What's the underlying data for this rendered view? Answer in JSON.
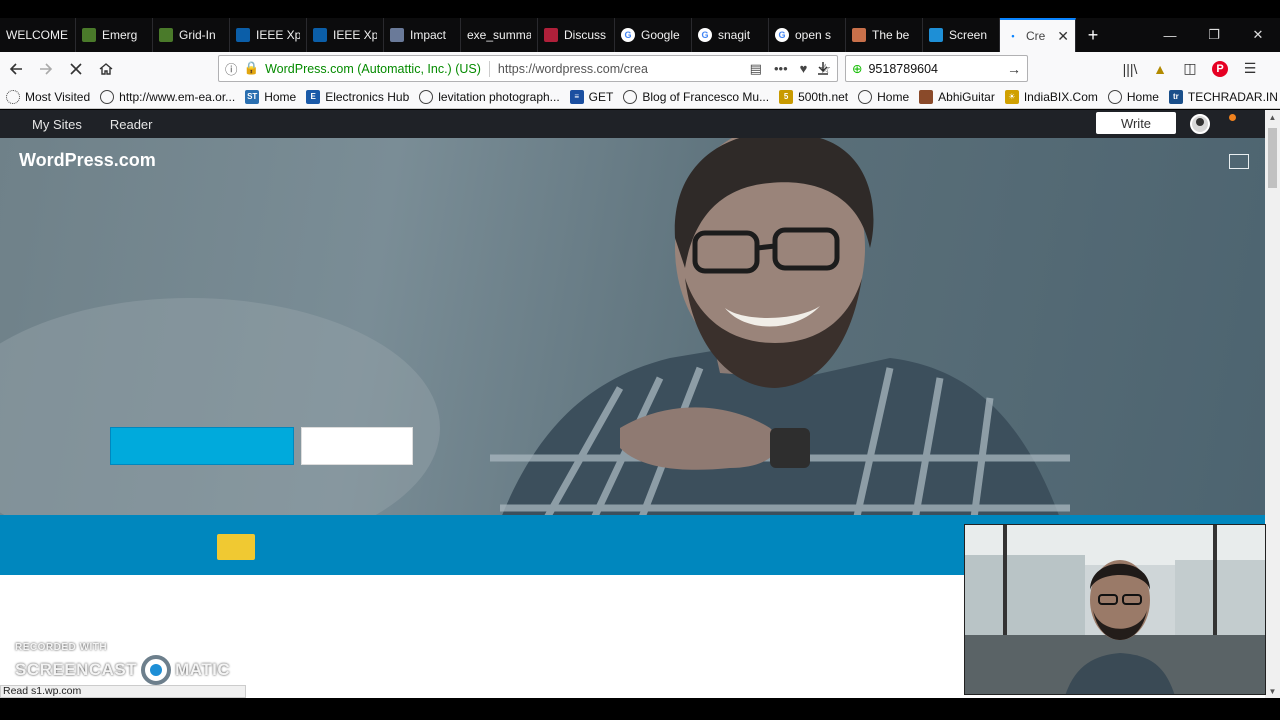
{
  "browser": {
    "tabs": [
      {
        "label": "WELCOME",
        "icon": "none"
      },
      {
        "label": "Emerg",
        "icon": "leaf-icon"
      },
      {
        "label": "Grid-In",
        "icon": "leaf-icon"
      },
      {
        "label": "IEEE Xp",
        "icon": "ieee-icon"
      },
      {
        "label": "IEEE Xp",
        "icon": "ieee-icon"
      },
      {
        "label": "Impact",
        "icon": "globe-icon"
      },
      {
        "label": "exe_summa",
        "icon": "none"
      },
      {
        "label": "Discuss",
        "icon": "chat-icon"
      },
      {
        "label": "Google",
        "icon": "google-icon"
      },
      {
        "label": "snagit",
        "icon": "google-icon"
      },
      {
        "label": "open s",
        "icon": "google-icon"
      },
      {
        "label": "The be",
        "icon": "person-icon"
      },
      {
        "label": "Screen",
        "icon": "screencast-icon"
      },
      {
        "label": "Cre",
        "icon": "loading-icon",
        "active": true
      }
    ],
    "new_tab_label": "+",
    "window_controls": [
      "—",
      "❐",
      "✕"
    ],
    "identity": "WordPress.com (Automattic, Inc.) (US)",
    "url": "https://wordpress.com/crea",
    "search_value": "9518789604",
    "bookmarks": [
      {
        "label": "Most Visited",
        "icon": "gear-icon"
      },
      {
        "label": "http://www.em-ea.or...",
        "icon": "globe-icon"
      },
      {
        "label": "Home",
        "icon": "st-icon"
      },
      {
        "label": "Electronics Hub",
        "icon": "e-icon"
      },
      {
        "label": "levitation photograph...",
        "icon": "globe-icon"
      },
      {
        "label": "GET",
        "icon": "get-icon"
      },
      {
        "label": "Blog of Francesco Mu...",
        "icon": "globe-icon"
      },
      {
        "label": "500th.net",
        "icon": "50-icon"
      },
      {
        "label": "Home",
        "icon": "globe-icon"
      },
      {
        "label": "AbhiGuitar",
        "icon": "image-icon"
      },
      {
        "label": "IndiaBIX.Com",
        "icon": "bix-icon"
      },
      {
        "label": "Home",
        "icon": "globe-icon"
      },
      {
        "label": "TECHRADAR.IN",
        "icon": "tr-icon"
      }
    ],
    "status_text": "Read s1.wp.com"
  },
  "masterbar": {
    "my_sites": "My Sites",
    "reader": "Reader",
    "write": "Write"
  },
  "hero": {
    "brand": "WordPress.com"
  },
  "watermark": {
    "line1": "RECORDED WITH",
    "left": "SCREENCAST",
    "right": "MATIC"
  },
  "colors": {
    "masterbar": "#1f2227",
    "cta_primary": "#00aadc",
    "band": "#0087be",
    "yellow_button": "#f0c932",
    "secure_green": "#058b00"
  }
}
